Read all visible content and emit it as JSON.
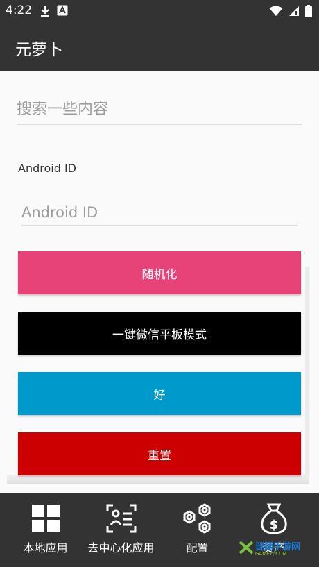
{
  "status_bar": {
    "time": "4:22",
    "left_icons": [
      "download-icon",
      "app-notification-icon"
    ],
    "right_icons": [
      "wifi-icon",
      "signal-icon",
      "battery-icon"
    ]
  },
  "toolbar": {
    "title": "元萝卜"
  },
  "search": {
    "placeholder": "搜索一些内容",
    "value": ""
  },
  "android_id": {
    "label": "Android ID",
    "placeholder": "Android ID",
    "value": ""
  },
  "buttons": {
    "randomize": {
      "label": "随机化",
      "color": "#e84378"
    },
    "wechat_tablet": {
      "label": "一键微信平板模式",
      "color": "#000000"
    },
    "ok": {
      "label": "好",
      "color": "#0099cc"
    },
    "reset": {
      "label": "重置",
      "color": "#cc0000"
    }
  },
  "bottom_nav": {
    "items": [
      {
        "label": "本地应用",
        "icon": "grid-icon"
      },
      {
        "label": "去中心化应用",
        "icon": "face-scan-icon"
      },
      {
        "label": "配置",
        "icon": "hexagon-nuts-icon"
      },
      {
        "label": "资产",
        "icon": "money-bag-icon"
      }
    ]
  },
  "watermark": {
    "text": "谜题手游网",
    "sub": "GAMEYJ.COM"
  }
}
